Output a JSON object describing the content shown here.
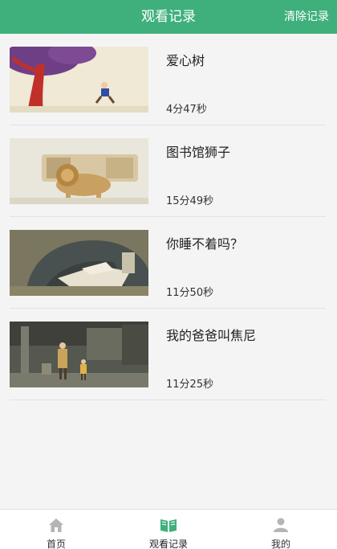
{
  "header": {
    "title": "观看记录",
    "clear_label": "清除记录"
  },
  "history": [
    {
      "title": "爱心树",
      "duration": "4分47秒"
    },
    {
      "title": "图书馆狮子",
      "duration": "15分49秒"
    },
    {
      "title": "你睡不着吗？",
      "duration": "11分50秒"
    },
    {
      "title": "我的爸爸叫焦尼",
      "duration": "11分25秒"
    }
  ],
  "nav": {
    "home": "首页",
    "history": "观看记录",
    "mine": "我的"
  },
  "colors": {
    "accent": "#3fb07c",
    "inactive_icon": "#b5b5b5"
  }
}
